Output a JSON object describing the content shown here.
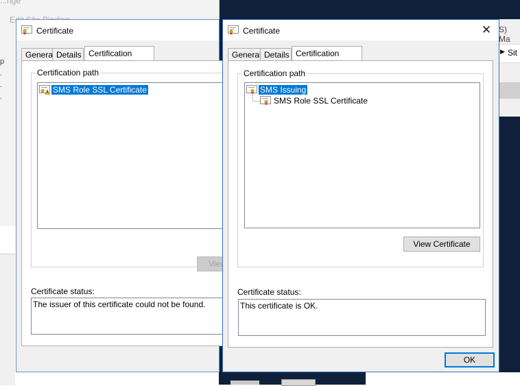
{
  "background": {
    "edit_site_binding_title": "Edit Site Binding",
    "top_fragment": "...nge",
    "left_fragments": [
      "p",
      ".",
      ".",
      "."
    ],
    "right_window_title_fragment": "S) Ma",
    "right_window_nav_text": "Sit"
  },
  "left_dialog": {
    "title": "Certificate",
    "tabs": [
      "General",
      "Details",
      "Certification Path"
    ],
    "active_tab": "Certification Path",
    "group_label": "Certification path",
    "tree": [
      {
        "label": "SMS Role SSL Certificate",
        "icon": "certificate-warning-icon",
        "selected": true,
        "level": 0
      }
    ],
    "view_button": "View",
    "status_label": "Certificate status:",
    "status_text": "The issuer of this certificate could not be found."
  },
  "right_dialog": {
    "title": "Certificate",
    "close_glyph": "✕",
    "tabs": [
      "General",
      "Details",
      "Certification Path"
    ],
    "active_tab": "Certification Path",
    "group_label": "Certification path",
    "tree": [
      {
        "label": "SMS Issuing",
        "icon": "certificate-icon",
        "selected": true,
        "level": 0
      },
      {
        "label": "SMS Role SSL Certificate",
        "icon": "certificate-icon",
        "selected": false,
        "level": 1
      }
    ],
    "view_button": "View Certificate",
    "status_label": "Certificate status:",
    "status_text": "This certificate is OK.",
    "ok_button": "OK"
  },
  "colors": {
    "selection": "#0078d7",
    "desktop": "#10203a",
    "dialog_bg": "#f0f0f0",
    "certificate_ribbon": "#d4a017"
  }
}
